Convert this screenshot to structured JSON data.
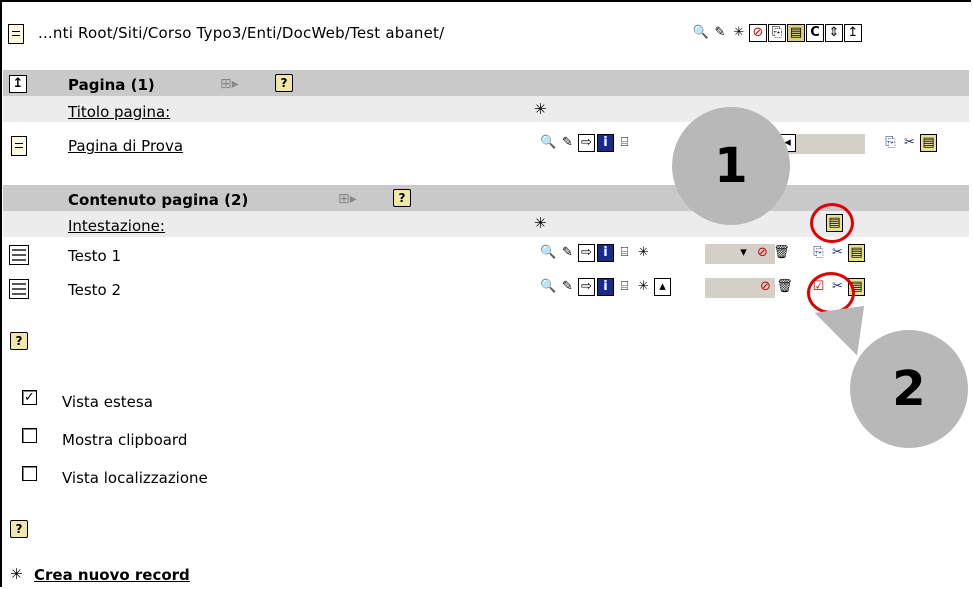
{
  "path": {
    "text": "...nti Root/Siti/Corso Typo3/Enti/DocWeb/Test abanet/",
    "toolbar": [
      "🔍",
      "✎",
      "✳",
      "⊘",
      "⎘",
      "📋",
      "C",
      "⇕",
      "↥"
    ]
  },
  "pages_section": {
    "header": "Pagina (1)",
    "column_label": "Titolo pagina:",
    "rows": [
      {
        "title": "Pagina di Prova"
      }
    ]
  },
  "content_section": {
    "header": "Contenuto pagina (2)",
    "column_label": "Intestazione:",
    "rows": [
      {
        "title": "Testo 1"
      },
      {
        "title": "Testo 2"
      }
    ]
  },
  "callouts": {
    "one": "1",
    "two": "2"
  },
  "options": {
    "extended_view": {
      "label": "Vista estesa",
      "checked": true
    },
    "show_clipboard": {
      "label": "Mostra clipboard",
      "checked": false
    },
    "localization_view": {
      "label": "Vista localizzazione",
      "checked": false
    }
  },
  "footer": {
    "new_record": "Crea nuovo record"
  },
  "glyphs": {
    "help": "?",
    "check": "✓",
    "up": "↥",
    "plus": "⊞▸",
    "new": "✳"
  }
}
